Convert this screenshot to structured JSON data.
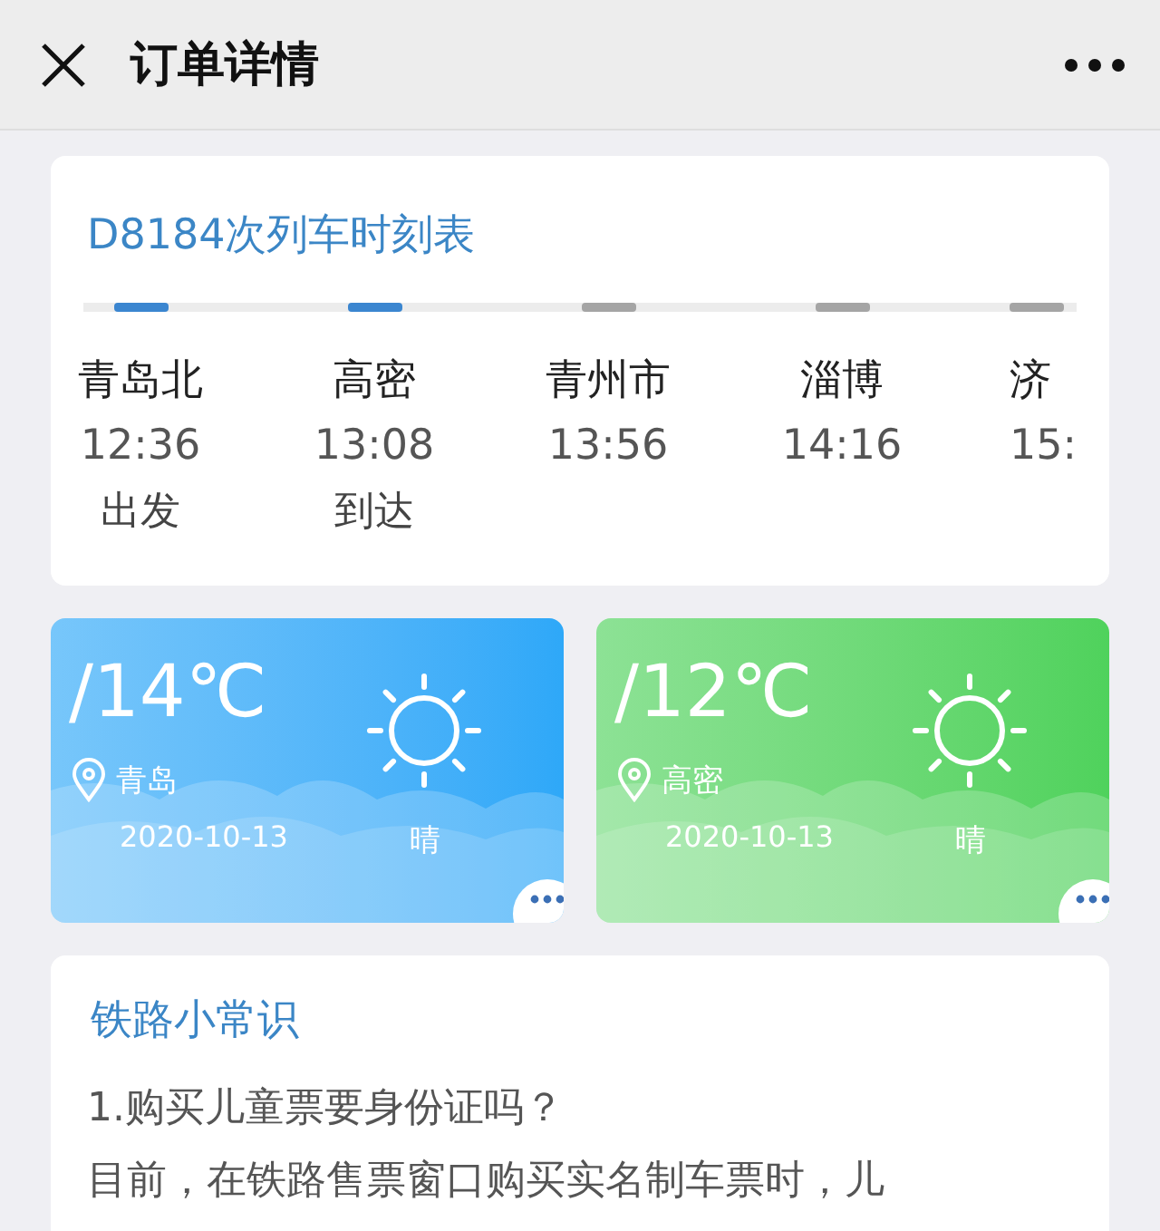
{
  "header": {
    "title": "订单详情"
  },
  "timetable": {
    "title": "D8184次列车时刻表",
    "stations": [
      {
        "name": "青岛北",
        "time": "12:36",
        "status": "出发",
        "passed": true
      },
      {
        "name": "高密",
        "time": "13:08",
        "status": "到达",
        "passed": true
      },
      {
        "name": "青州市",
        "time": "13:56",
        "passed": false
      },
      {
        "name": "淄博",
        "time": "14:16",
        "passed": false
      },
      {
        "name": "济",
        "time": "15:",
        "passed": false
      }
    ]
  },
  "weather": [
    {
      "temperature": "/14℃",
      "city": "青岛",
      "date": "2020-10-13",
      "condition": "晴",
      "color": "#2ea8f8"
    },
    {
      "temperature": "/12℃",
      "city": "高密",
      "date": "2020-10-13",
      "condition": "晴",
      "color": "#4fd25c"
    }
  ],
  "tips": {
    "title": "铁路小常识",
    "question": "1.购买儿童票要身份证吗？",
    "answer": "目前，在铁路售票窗口购买实名制车票时，儿"
  }
}
